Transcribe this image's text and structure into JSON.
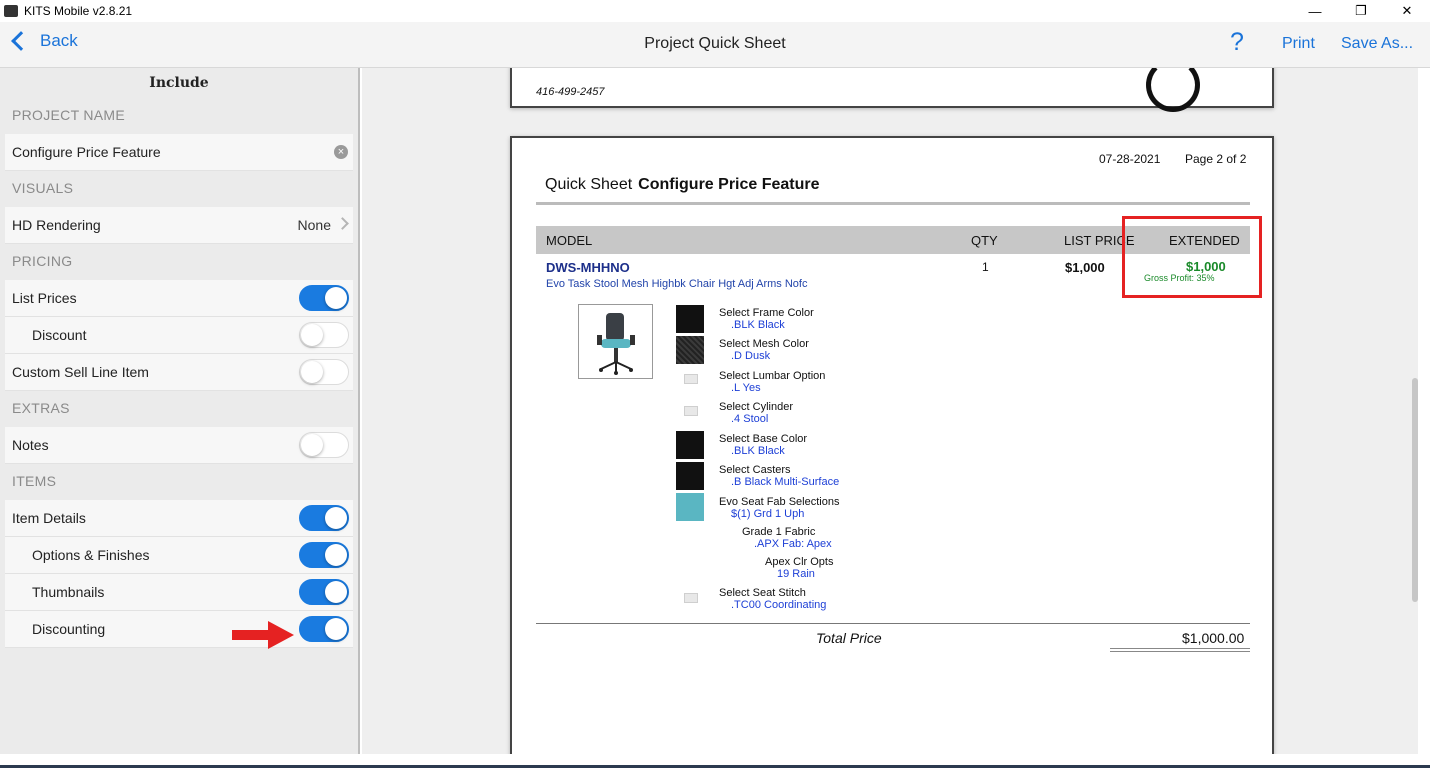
{
  "window": {
    "title": "KITS Mobile v2.8.21",
    "minimize": "—",
    "restore": "❐",
    "close": "✕"
  },
  "nav": {
    "back": "Back",
    "title": "Project Quick Sheet",
    "help": "?",
    "print": "Print",
    "save_as": "Save As..."
  },
  "sidebar": {
    "header": "Include",
    "project_name_label": "PROJECT NAME",
    "project_name_value": "Configure Price Feature",
    "visuals_label": "VISUALS",
    "hd_rendering": {
      "label": "HD Rendering",
      "value": "None"
    },
    "pricing_label": "PRICING",
    "list_prices": {
      "label": "List Prices",
      "on": true
    },
    "discount": {
      "label": "Discount",
      "on": false
    },
    "custom_sell": {
      "label": "Custom Sell Line Item",
      "on": false
    },
    "extras_label": "EXTRAS",
    "notes": {
      "label": "Notes",
      "on": false
    },
    "items_label": "ITEMS",
    "item_details": {
      "label": "Item Details",
      "on": true
    },
    "options_finishes": {
      "label": "Options & Finishes",
      "on": true
    },
    "thumbnails": {
      "label": "Thumbnails",
      "on": true
    },
    "discounting": {
      "label": "Discounting",
      "on": true
    }
  },
  "document": {
    "phone": "416-499-2457",
    "date": "07-28-2021",
    "page": "Page 2 of 2",
    "qs_label": "Quick Sheet",
    "qs_name": "Configure Price Feature",
    "columns": {
      "model": "MODEL",
      "qty": "QTY",
      "list_price": "LIST PRICE",
      "extended": "EXTENDED"
    },
    "item": {
      "model": "DWS-MHHNO",
      "description": "Evo Task Stool Mesh Highbk Chair Hgt Adj Arms Nofc",
      "qty": "1",
      "list_price": "$1,000",
      "extended": "$1,000",
      "gross_profit": "Gross Profit: 35%"
    },
    "options": [
      {
        "k": "Select Frame Color",
        "v": ".BLK   Black"
      },
      {
        "k": "Select Mesh Color",
        "v": ".D   Dusk"
      },
      {
        "k": "Select Lumbar Option",
        "v": ".L   Yes"
      },
      {
        "k": "Select Cylinder",
        "v": ".4   Stool"
      },
      {
        "k": "Select Base Color",
        "v": ".BLK   Black"
      },
      {
        "k": "Select Casters",
        "v": ".B   Black Multi-Surface"
      },
      {
        "k": "Evo Seat Fab Selections",
        "v": "$(1)   Grd 1 Uph"
      },
      {
        "k": "Grade 1 Fabric",
        "v": ".APX   Fab: Apex"
      },
      {
        "k": "Apex Clr Opts",
        "v": "19   Rain"
      },
      {
        "k": "Select Seat Stitch",
        "v": ".TC00   Coordinating"
      }
    ],
    "total_label": "Total Price",
    "total_value": "$1,000.00"
  }
}
